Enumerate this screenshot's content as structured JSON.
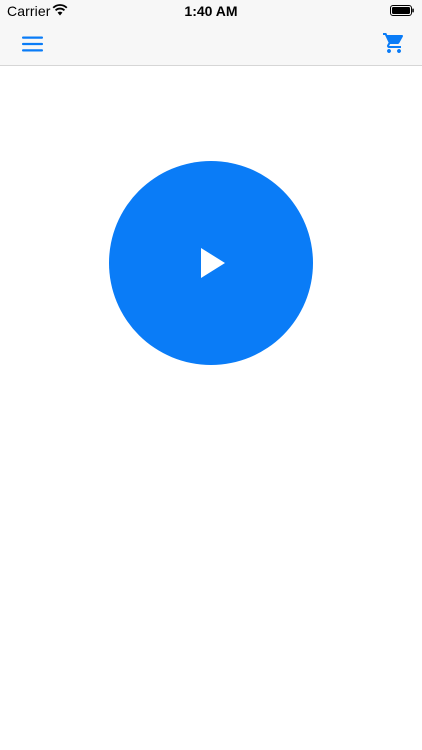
{
  "status_bar": {
    "carrier": "Carrier",
    "time": "1:40 AM",
    "wifi_icon": "wifi-icon",
    "battery_icon": "battery-icon"
  },
  "nav_bar": {
    "menu_icon": "hamburger-menu-icon",
    "cart_icon": "shopping-cart-icon"
  },
  "main": {
    "play_icon": "play-icon"
  },
  "colors": {
    "accent": "#0a7cf7",
    "nav_background": "#f7f7f7",
    "background": "#ffffff"
  }
}
